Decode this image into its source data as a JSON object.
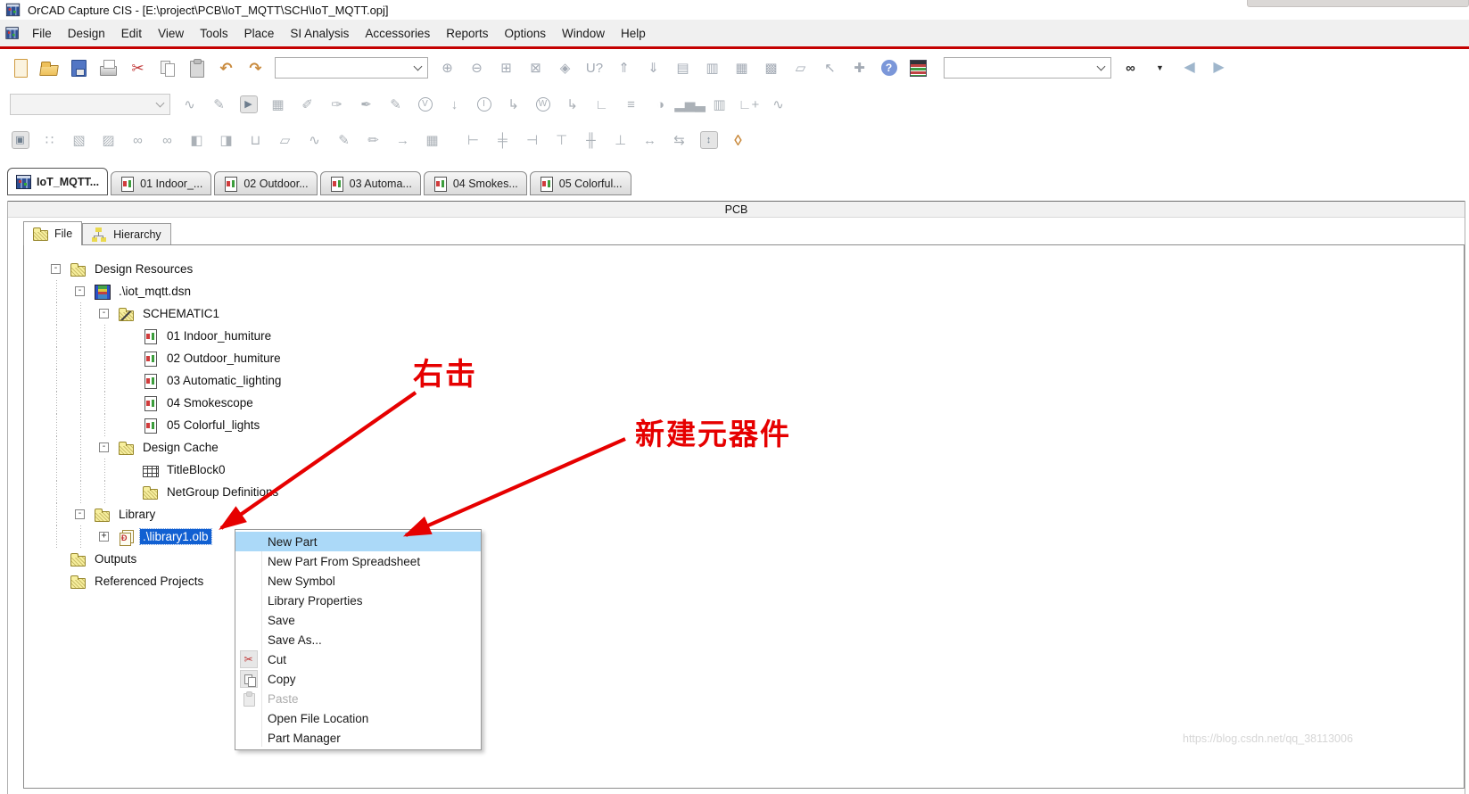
{
  "window": {
    "title": "OrCAD Capture CIS - [E:\\project\\PCB\\IoT_MQTT\\SCH\\IoT_MQTT.opj]"
  },
  "menubar": {
    "items": [
      {
        "label": "File",
        "name": "menu-file"
      },
      {
        "label": "Design",
        "name": "menu-design"
      },
      {
        "label": "Edit",
        "name": "menu-edit"
      },
      {
        "label": "View",
        "name": "menu-view"
      },
      {
        "label": "Tools",
        "name": "menu-tools"
      },
      {
        "label": "Place",
        "name": "menu-place"
      },
      {
        "label": "SI Analysis",
        "name": "menu-si-analysis"
      },
      {
        "label": "Accessories",
        "name": "menu-accessories"
      },
      {
        "label": "Reports",
        "name": "menu-reports"
      },
      {
        "label": "Options",
        "name": "menu-options"
      },
      {
        "label": "Window",
        "name": "menu-window"
      },
      {
        "label": "Help",
        "name": "menu-help"
      }
    ]
  },
  "toolbar1": {
    "left_icons": [
      {
        "name": "new-design-icon",
        "cls": "ic-new",
        "glyph": ""
      },
      {
        "name": "open-document-icon",
        "cls": "ic-open",
        "glyph": ""
      },
      {
        "name": "save-icon",
        "cls": "ic-save",
        "glyph": ""
      },
      {
        "name": "print-icon",
        "cls": "ic-print",
        "glyph": ""
      },
      {
        "name": "cut-icon",
        "cls": "red",
        "glyph": "✂"
      },
      {
        "name": "copy-icon",
        "cls": "ic-copy",
        "glyph": ""
      },
      {
        "name": "paste-icon",
        "cls": "ic-paste",
        "glyph": ""
      },
      {
        "name": "undo-icon",
        "cls": "amber",
        "glyph": "↶"
      },
      {
        "name": "redo-icon",
        "cls": "amber",
        "glyph": "↷"
      }
    ],
    "view_scale_combo": {
      "value": ""
    },
    "mid_icons": [
      {
        "name": "zoom-in-icon",
        "glyph": "⊕"
      },
      {
        "name": "zoom-out-icon",
        "glyph": "⊖"
      },
      {
        "name": "zoom-area-icon",
        "glyph": "⊞"
      },
      {
        "name": "zoom-all-icon",
        "glyph": "⊠"
      },
      {
        "name": "fisheye-view-icon",
        "glyph": "◈"
      },
      {
        "name": "goto-part-icon",
        "glyph": "U?"
      },
      {
        "name": "ascend-hierarchy-icon",
        "glyph": "⇑"
      },
      {
        "name": "descend-hierarchy-icon",
        "glyph": "⇓"
      },
      {
        "name": "new-document-icon",
        "glyph": "▤"
      },
      {
        "name": "session-log-icon",
        "glyph": "▥"
      },
      {
        "name": "spreadsheet-icon",
        "glyph": "▦"
      },
      {
        "name": "design-rules-icon",
        "glyph": "▩"
      },
      {
        "name": "copy-object-icon",
        "glyph": "▱"
      },
      {
        "name": "select-tool-icon",
        "glyph": "↖"
      },
      {
        "name": "netgroup-icon",
        "glyph": "✚"
      },
      {
        "name": "help-icon",
        "cls": "hlp",
        "glyph": "?"
      },
      {
        "name": "cis-explorer-icon",
        "cls": "ic-cm",
        "glyph": ""
      }
    ],
    "search_combo": {
      "value": ""
    },
    "right_icons": [
      {
        "name": "find-icon",
        "cls": "dark",
        "glyph": "∞"
      },
      {
        "name": "find-options-icon",
        "cls": "dark sm",
        "glyph": "▼"
      },
      {
        "name": "back-icon",
        "cls": "navy",
        "glyph": "◀"
      },
      {
        "name": "forward-icon",
        "cls": "navy",
        "glyph": "▶"
      }
    ]
  },
  "toolbar2": {
    "simulation_profile_combo": {
      "value": ""
    },
    "icons": [
      {
        "name": "new-simulation-profile-icon",
        "glyph": "∿"
      },
      {
        "name": "edit-simulation-profile-icon",
        "glyph": "✎"
      },
      {
        "name": "run-pspice-icon",
        "cls": "runbox",
        "glyph": "▶"
      },
      {
        "name": "view-simulation-results-icon",
        "glyph": "▦"
      },
      {
        "name": "voltage-probe-icon",
        "glyph": "✐"
      },
      {
        "name": "voltage-diff-probe-icon",
        "glyph": "✑"
      },
      {
        "name": "current-probe-icon",
        "glyph": "✒"
      },
      {
        "name": "power-probe-icon",
        "glyph": "✎"
      },
      {
        "name": "voltage-level-marker-icon",
        "cls": "circ",
        "glyph": "V"
      },
      {
        "name": "voltage-marker-icon",
        "glyph": "↓"
      },
      {
        "name": "current-marker-icon",
        "cls": "circ",
        "glyph": "I"
      },
      {
        "name": "current-pin-marker-icon",
        "glyph": "↳"
      },
      {
        "name": "power-marker-icon",
        "cls": "circ",
        "glyph": "W"
      },
      {
        "name": "power-pin-marker-icon",
        "glyph": "↳"
      },
      {
        "name": "plot-window-icon",
        "glyph": "∟"
      },
      {
        "name": "plot-axis-icon",
        "glyph": "≡"
      },
      {
        "name": "plot-settings-icon",
        "glyph": "◑"
      },
      {
        "name": "bar-graph-icon",
        "glyph": "▂▅▃"
      },
      {
        "name": "histogram-icon",
        "glyph": "▥"
      },
      {
        "name": "add-trace-icon",
        "glyph": "∟+"
      },
      {
        "name": "eval-measurement-icon",
        "glyph": "∿"
      }
    ]
  },
  "toolbar3": {
    "icons": [
      {
        "name": "cis-camera-icon",
        "cls": "runbox",
        "glyph": "▣"
      },
      {
        "name": "part-database-icon",
        "glyph": "∷"
      },
      {
        "name": "verify-part-icon",
        "glyph": "▧"
      },
      {
        "name": "grid-select-icon",
        "glyph": "▨"
      },
      {
        "name": "link-database-part-icon",
        "glyph": "∞"
      },
      {
        "name": "link-part-icon",
        "glyph": "∞"
      },
      {
        "name": "update-part-cache-icon",
        "glyph": "◧"
      },
      {
        "name": "import-document-icon",
        "glyph": "◨"
      },
      {
        "name": "bom-cart-icon",
        "glyph": "⊔"
      },
      {
        "name": "copy-tag-icon",
        "glyph": "▱"
      },
      {
        "name": "waveform-tag-icon",
        "glyph": "∿"
      },
      {
        "name": "edit-part-icon",
        "glyph": "✎"
      },
      {
        "name": "edit-page-icon",
        "glyph": "✏"
      },
      {
        "name": "export-document-icon",
        "glyph": "→"
      },
      {
        "name": "parts-table-icon",
        "glyph": "▦"
      },
      {
        "name": "align-left-icon",
        "cls": "gap",
        "glyph": "⊢"
      },
      {
        "name": "align-center-icon",
        "glyph": "╪"
      },
      {
        "name": "align-right-icon",
        "glyph": "⊣"
      },
      {
        "name": "align-top-icon",
        "glyph": "⊤"
      },
      {
        "name": "align-middle-icon",
        "glyph": "╫"
      },
      {
        "name": "align-bottom-icon",
        "glyph": "⊥"
      },
      {
        "name": "distribute-horizontal-icon",
        "glyph": "↔"
      },
      {
        "name": "distribute-vertical-icon",
        "glyph": "⇆"
      },
      {
        "name": "fit-height-icon",
        "cls": "runbox",
        "glyph": "↕"
      },
      {
        "name": "tag-icon",
        "cls": "amber",
        "glyph": "◊"
      }
    ]
  },
  "doc_tabs": [
    {
      "label": "IoT_MQTT...",
      "name": "tab-iot-mqtt",
      "state": "active",
      "icon": "ti-pm",
      "icon_name": "project-manager-icon"
    },
    {
      "label": "01 Indoor_...",
      "name": "tab-01-indoor",
      "icon": "ti-page",
      "icon_name": "schematic-page-icon"
    },
    {
      "label": "02 Outdoor...",
      "name": "tab-02-outdoor",
      "icon": "ti-page",
      "icon_name": "schematic-page-icon"
    },
    {
      "label": "03 Automa...",
      "name": "tab-03-automatic",
      "icon": "ti-page",
      "icon_name": "schematic-page-icon"
    },
    {
      "label": "04 Smokes...",
      "name": "tab-04-smokescope",
      "icon": "ti-page",
      "icon_name": "schematic-page-icon"
    },
    {
      "label": "05 Colorful...",
      "name": "tab-05-colorful",
      "icon": "ti-page",
      "icon_name": "schematic-page-icon"
    }
  ],
  "panel": {
    "caption": "PCB",
    "tabs": [
      {
        "label": "File",
        "name": "panel-tab-file",
        "state": "active",
        "icon": "ti-folder",
        "icon_name": "folder-icon"
      },
      {
        "label": "Hierarchy",
        "name": "panel-tab-hierarchy",
        "icon": "ti-hier",
        "icon_name": "hierarchy-icon"
      }
    ]
  },
  "tree": {
    "items": [
      {
        "depth": 0,
        "exp": "-",
        "icon": "ti-folder",
        "icon_name": "folder-icon",
        "label": "Design Resources",
        "name": "tree-item-design-resources"
      },
      {
        "depth": 1,
        "exp": "-",
        "icon": "ti-dsn",
        "icon_name": "design-file-icon",
        "label": ".\\iot_mqtt.dsn",
        "name": "tree-item-iot-mqtt-dsn"
      },
      {
        "depth": 2,
        "exp": "-",
        "icon": "ti-schfolder",
        "icon_name": "schematic-folder-icon",
        "label": "SCHEMATIC1",
        "name": "tree-item-schematic1"
      },
      {
        "depth": 3,
        "exp": "",
        "icon": "ti-page",
        "icon_name": "schematic-page-icon",
        "label": "01 Indoor_humiture",
        "name": "tree-item-01-indoor-humiture"
      },
      {
        "depth": 3,
        "exp": "",
        "icon": "ti-page",
        "icon_name": "schematic-page-icon",
        "label": "02 Outdoor_humiture",
        "name": "tree-item-02-outdoor-humiture"
      },
      {
        "depth": 3,
        "exp": "",
        "icon": "ti-page",
        "icon_name": "schematic-page-icon",
        "label": "03 Automatic_lighting",
        "name": "tree-item-03-automatic-lighting"
      },
      {
        "depth": 3,
        "exp": "",
        "icon": "ti-page",
        "icon_name": "schematic-page-icon",
        "label": "04 Smokescope",
        "name": "tree-item-04-smokescope"
      },
      {
        "depth": 3,
        "exp": "",
        "icon": "ti-page",
        "icon_name": "schematic-page-icon",
        "label": "05 Colorful_lights",
        "name": "tree-item-05-colorful-lights"
      },
      {
        "depth": 2,
        "exp": "-",
        "icon": "ti-folder",
        "icon_name": "folder-icon",
        "label": "Design Cache",
        "name": "tree-item-design-cache"
      },
      {
        "depth": 3,
        "exp": "",
        "icon": "ti-titleblock",
        "icon_name": "titleblock-icon",
        "label": "TitleBlock0",
        "name": "tree-item-titleblock0"
      },
      {
        "depth": 3,
        "exp": "",
        "icon": "ti-folder",
        "icon_name": "folder-icon",
        "label": "NetGroup Definitions",
        "name": "tree-item-netgroup-definitions"
      },
      {
        "depth": 1,
        "exp": "-",
        "icon": "ti-folder",
        "icon_name": "folder-icon",
        "label": "Library",
        "name": "tree-item-library"
      },
      {
        "depth": 2,
        "exp": "+",
        "icon": "ti-olb",
        "icon_name": "library-file-icon",
        "label": ".\\library1.olb",
        "name": "tree-item-library1-olb",
        "state": "selected"
      },
      {
        "depth": 0,
        "exp": "",
        "icon": "ti-folder",
        "icon_name": "folder-icon",
        "label": "Outputs",
        "name": "tree-item-outputs"
      },
      {
        "depth": 0,
        "exp": "",
        "icon": "ti-folder",
        "icon_name": "folder-icon",
        "label": "Referenced Projects",
        "name": "tree-item-referenced-projects"
      }
    ]
  },
  "context_menu": {
    "items": [
      {
        "label": "New Part",
        "name": "menu-item-new-part",
        "state": "highlight"
      },
      {
        "label": "New Part From Spreadsheet",
        "name": "menu-item-new-part-from-spreadsheet"
      },
      {
        "label": "New Symbol",
        "name": "menu-item-new-symbol"
      },
      {
        "label": "Library Properties",
        "name": "menu-item-library-properties"
      },
      {
        "label": "Save",
        "name": "menu-item-save"
      },
      {
        "label": "Save As...",
        "name": "menu-item-save-as"
      },
      {
        "label": "Cut",
        "name": "menu-item-cut",
        "icon": "mi-cut",
        "icon_name": "cut-icon",
        "icon_glyph": "✂"
      },
      {
        "label": "Copy",
        "name": "menu-item-copy",
        "icon": "mi-copy",
        "icon_name": "copy-icon"
      },
      {
        "label": "Paste",
        "name": "menu-item-paste",
        "icon": "mi-paste",
        "icon_name": "paste-icon",
        "state": "disabled"
      },
      {
        "label": "Open File Location",
        "name": "menu-item-open-file-location"
      },
      {
        "label": "Part Manager",
        "name": "menu-item-part-manager"
      }
    ]
  },
  "annotations": {
    "right_click_label": "右击",
    "new_component_label": "新建元器件"
  },
  "watermark": "https://blog.csdn.net/qq_38113006",
  "colors": {
    "toolbar_separator_red": "#c40000",
    "annotation_red": "#e60000",
    "tree_selection_blue": "#1160d2",
    "menu_highlight_blue": "#abd9f8"
  }
}
